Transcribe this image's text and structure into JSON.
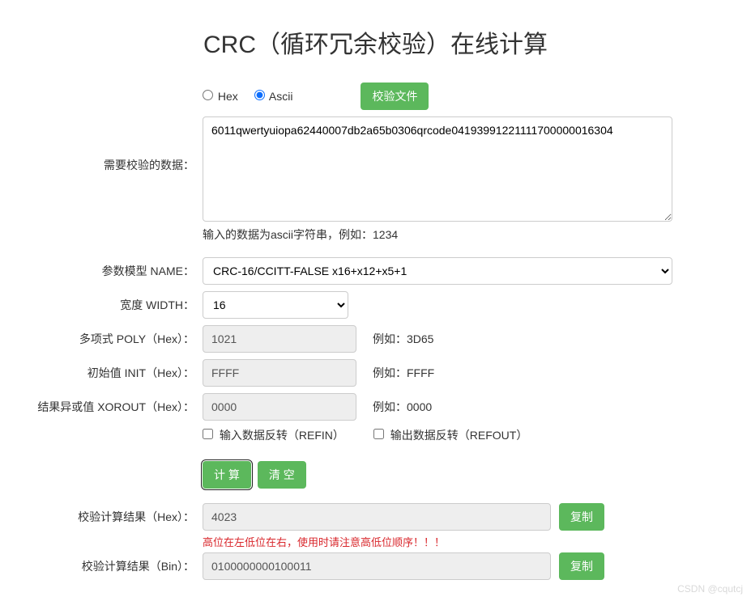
{
  "title": "CRC（循环冗余校验）在线计算",
  "format": {
    "hex_label": "Hex",
    "ascii_label": "Ascii",
    "selected": "ascii"
  },
  "verify_file_button": "校验文件",
  "data_section": {
    "label": "需要校验的数据：",
    "value": "6011qwertyuiopa62440007db2a65b0306qrcode04193991221111700000016304",
    "hint": "输入的数据为ascii字符串，例如：1234"
  },
  "model": {
    "label": "参数模型 NAME：",
    "selected": "CRC-16/CCITT-FALSE      x16+x12+x5+1"
  },
  "width": {
    "label": "宽度 WIDTH：",
    "selected": "16"
  },
  "poly": {
    "label": "多项式 POLY（Hex）：",
    "value": "1021",
    "example": "例如：3D65"
  },
  "init": {
    "label": "初始值 INIT（Hex）：",
    "value": "FFFF",
    "example": "例如：FFFF"
  },
  "xorout": {
    "label": "结果异或值 XOROUT（Hex）：",
    "value": "0000",
    "example": "例如：0000"
  },
  "refin": {
    "label": "输入数据反转（REFIN）",
    "checked": false
  },
  "refout": {
    "label": "输出数据反转（REFOUT）",
    "checked": false
  },
  "actions": {
    "calc": "计 算",
    "clear": "清 空",
    "copy": "复制"
  },
  "result_hex": {
    "label": "校验计算结果（Hex）：",
    "value": "4023",
    "note": "高位在左低位在右，使用时请注意高低位顺序！！！"
  },
  "result_bin": {
    "label": "校验计算结果（Bin）：",
    "value": "0100000000100011"
  },
  "watermark": "CSDN @cqutcj"
}
